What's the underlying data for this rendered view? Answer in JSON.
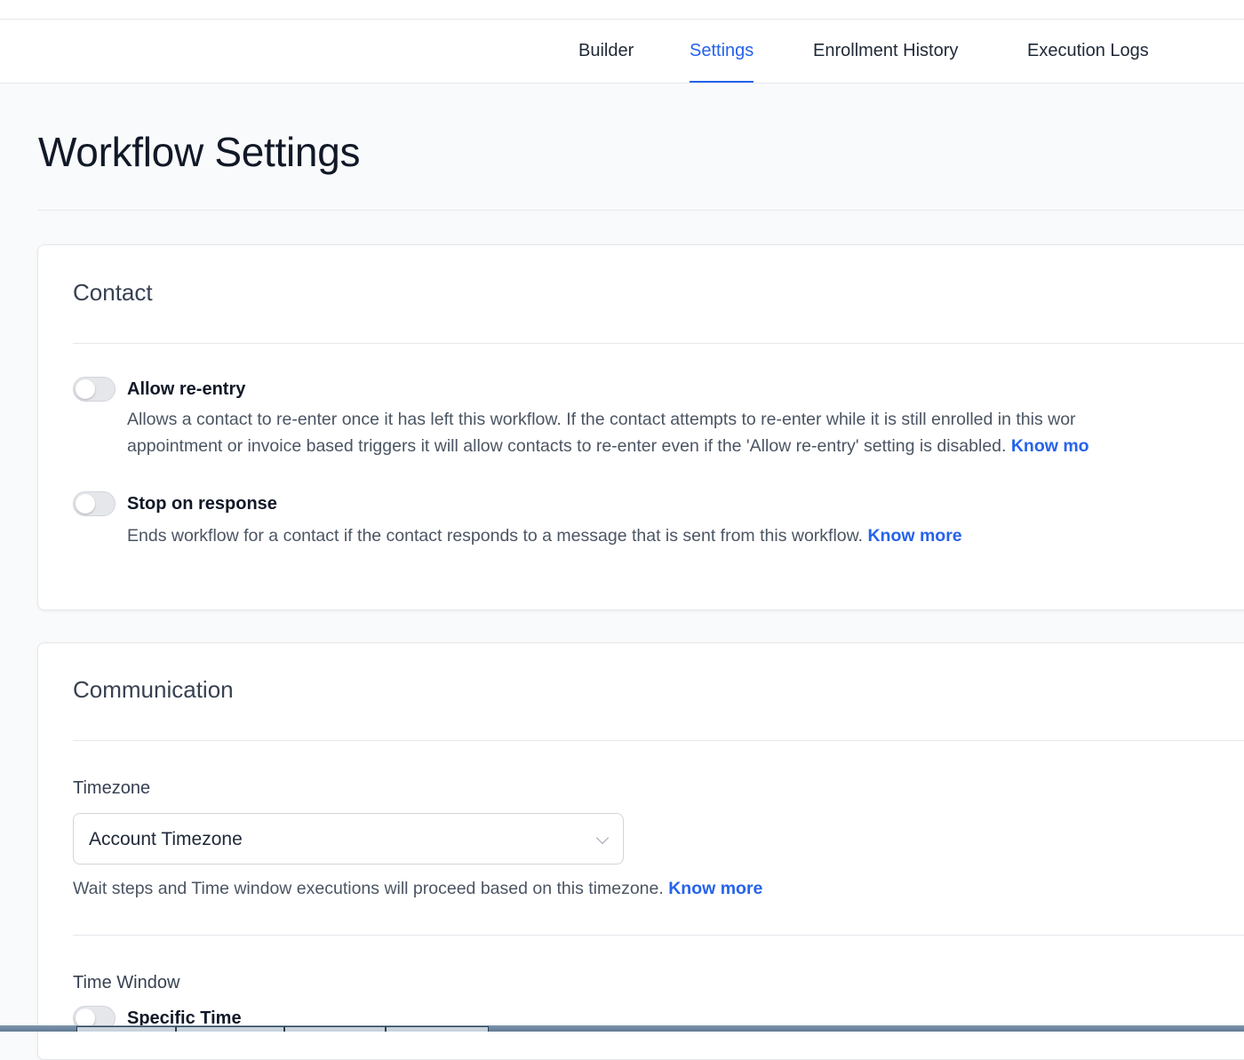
{
  "nav": {
    "tabs": [
      {
        "label": "Builder",
        "active": false
      },
      {
        "label": "Settings",
        "active": true
      },
      {
        "label": "Enrollment History",
        "active": false
      },
      {
        "label": "Execution Logs",
        "active": false
      }
    ]
  },
  "page": {
    "title": "Workflow Settings"
  },
  "contact": {
    "title": "Contact",
    "allow_reentry": {
      "label": "Allow re-entry",
      "enabled": false,
      "desc_line1": "Allows a contact to re-enter once it has left this workflow. If the contact attempts to re-enter while it is still enrolled in this wor",
      "desc_line2": "appointment or invoice based triggers it will allow contacts to re-enter even if the 'Allow re-entry' setting is disabled. ",
      "link": "Know mo"
    },
    "stop_on_response": {
      "label": "Stop on response",
      "enabled": false,
      "desc": "Ends workflow for a contact if the contact responds to a message that is sent from this workflow. ",
      "link": "Know more"
    }
  },
  "communication": {
    "title": "Communication",
    "timezone": {
      "label": "Timezone",
      "value": "Account Timezone",
      "help": "Wait steps and Time window executions will proceed based on this timezone. ",
      "link": "Know more"
    },
    "time_window": {
      "label": "Time Window",
      "specific_time_label": "Specific Time",
      "enabled": false
    }
  },
  "colors": {
    "accent": "#2563eb",
    "background": "#f9fafb",
    "card": "#ffffff"
  }
}
